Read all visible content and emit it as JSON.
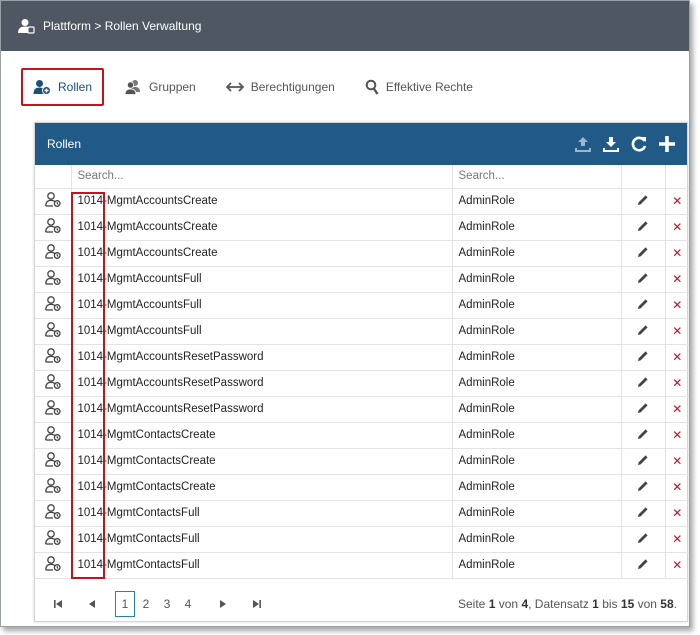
{
  "header": {
    "title": "Plattform > Rollen Verwaltung"
  },
  "tabs": [
    {
      "label": "Rollen",
      "icon": "user-add-icon"
    },
    {
      "label": "Gruppen",
      "icon": "group-icon"
    },
    {
      "label": "Berechtigungen",
      "icon": "arrows-icon"
    },
    {
      "label": "Effektive Rechte",
      "icon": "search-icon"
    }
  ],
  "panel": {
    "title": "Rollen",
    "toolbar_icons": [
      "upload-icon",
      "download-icon",
      "refresh-icon",
      "add-icon"
    ],
    "filter": {
      "name_placeholder": "Search...",
      "type_placeholder": "Search..."
    },
    "rows": [
      {
        "name": "1014-MgmtAccountsCreate",
        "type": "AdminRole"
      },
      {
        "name": "1014-MgmtAccountsCreate",
        "type": "AdminRole"
      },
      {
        "name": "1014-MgmtAccountsCreate",
        "type": "AdminRole"
      },
      {
        "name": "1014-MgmtAccountsFull",
        "type": "AdminRole"
      },
      {
        "name": "1014-MgmtAccountsFull",
        "type": "AdminRole"
      },
      {
        "name": "1014-MgmtAccountsFull",
        "type": "AdminRole"
      },
      {
        "name": "1014-MgmtAccountsResetPassword",
        "type": "AdminRole"
      },
      {
        "name": "1014-MgmtAccountsResetPassword",
        "type": "AdminRole"
      },
      {
        "name": "1014-MgmtAccountsResetPassword",
        "type": "AdminRole"
      },
      {
        "name": "1014-MgmtContactsCreate",
        "type": "AdminRole"
      },
      {
        "name": "1014-MgmtContactsCreate",
        "type": "AdminRole"
      },
      {
        "name": "1014-MgmtContactsCreate",
        "type": "AdminRole"
      },
      {
        "name": "1014-MgmtContactsFull",
        "type": "AdminRole"
      },
      {
        "name": "1014-MgmtContactsFull",
        "type": "AdminRole"
      },
      {
        "name": "1014-MgmtContactsFull",
        "type": "AdminRole"
      }
    ],
    "delete_glyph": "✕"
  },
  "pager": {
    "pages": [
      "1",
      "2",
      "3",
      "4"
    ],
    "current": "1",
    "info": {
      "seite_label": "Seite",
      "seite": "1",
      "von_label": "von",
      "total_pages": "4",
      "datensatz_label": ", Datensatz",
      "from": "1",
      "bis_label": "bis",
      "to": "15",
      "von2_label": "von",
      "total": "58",
      "end": "."
    }
  },
  "colors": {
    "header_bg": "#4f5763",
    "panel_header_bg": "#215a87",
    "highlight": "#c0151f",
    "delete": "#c0151f"
  }
}
